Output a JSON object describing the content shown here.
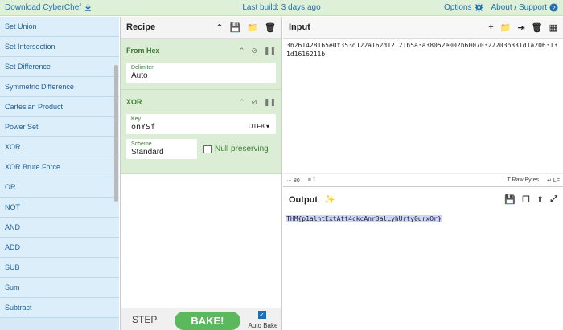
{
  "topbar": {
    "download": "Download CyberChef",
    "build": "Last build: 3 days ago",
    "options": "Options",
    "about": "About / Support"
  },
  "operations": [
    "Set Union",
    "Set Intersection",
    "Set Difference",
    "Symmetric Difference",
    "Cartesian Product",
    "Power Set",
    "XOR",
    "XOR Brute Force",
    "OR",
    "NOT",
    "AND",
    "ADD",
    "SUB",
    "Sum",
    "Subtract"
  ],
  "recipe": {
    "title": "Recipe",
    "from_hex": {
      "name": "From Hex",
      "delimiter_label": "Delimiter",
      "delimiter_value": "Auto"
    },
    "xor": {
      "name": "XOR",
      "key_label": "Key",
      "key_value": "onYSf",
      "key_encoding": "UTF8",
      "scheme_label": "Scheme",
      "scheme_value": "Standard",
      "null_label": "Null preserving"
    },
    "step": "STEP",
    "bake": "BAKE!",
    "auto_bake": "Auto Bake"
  },
  "input": {
    "title": "Input",
    "text": "3b261428165e0f353d122a162d12121b5a3a38052e002b60070322203b331d1a2063131d1616211b",
    "length": "80",
    "lines": "1",
    "raw_bytes": "Raw Bytes",
    "lf": "LF"
  },
  "output": {
    "title": "Output",
    "text": "THM{p1alntExtAtt4ckcAnr3alLyhUrty0urxOr}"
  },
  "colors": {
    "accent": "#5cb85c",
    "link": "#1f6fb2",
    "ops_bg": "#d5e9f6",
    "ingredient_bg": "#dcedd5"
  }
}
